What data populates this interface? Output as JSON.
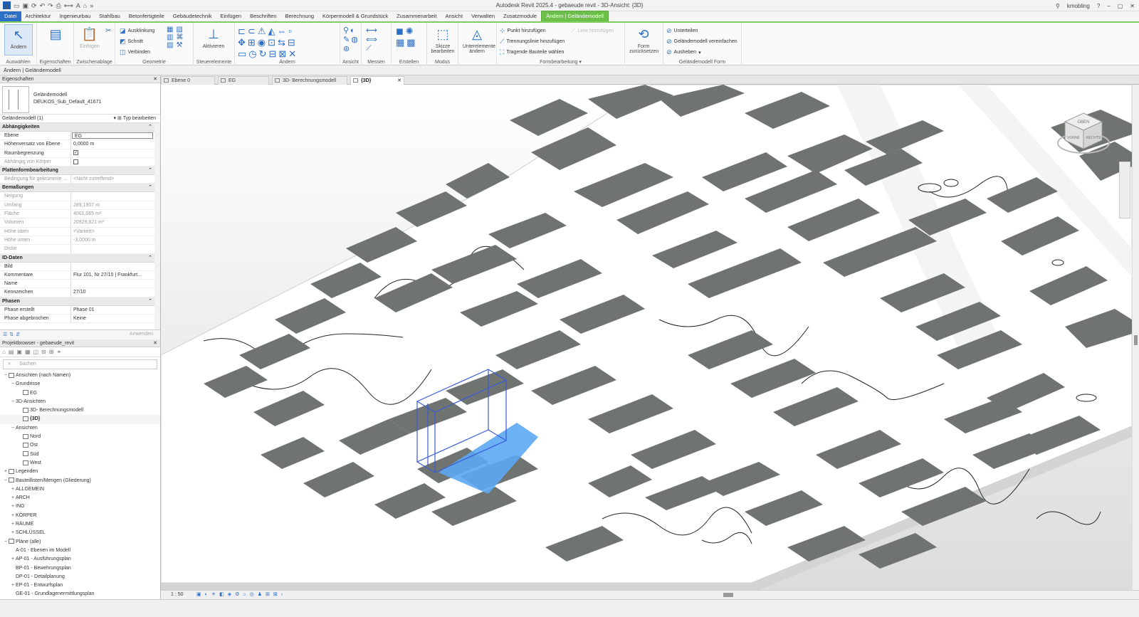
{
  "app": {
    "title": "Autodesk Revit 2025.4 - gebaeude revit - 3D-Ansicht: {3D}",
    "user": "kmobling",
    "logo_letter": "R"
  },
  "menu": {
    "tabs": [
      "Datei",
      "Architektur",
      "Ingenieurbau",
      "Stahlbau",
      "Betonfertigteile",
      "Gebäudetechnik",
      "Einfügen",
      "Beschriften",
      "Berechnung",
      "Körpermodell & Grundstück",
      "Zusammenarbeit",
      "Ansicht",
      "Verwalten",
      "Zusatzmodule",
      "Ändern | Geländemodell"
    ]
  },
  "ribbon": {
    "select": {
      "button": "Ändern",
      "label": "Auswählen"
    },
    "properties": {
      "label": "Eigenschaften"
    },
    "clipboard": {
      "paste": "Einfügen",
      "label": "Zwischenablage"
    },
    "geometry": {
      "items": [
        "Ausklinkung",
        "Schnitt",
        "Verbinden"
      ],
      "label": "Geometrie"
    },
    "controls": {
      "button": "Aktivieren",
      "label": "Steuerelemente"
    },
    "modify": {
      "label": "Ändern"
    },
    "view": {
      "label": "Ansicht"
    },
    "measure": {
      "label": "Messen"
    },
    "create": {
      "label": "Erstellen"
    },
    "mode": {
      "button_1": "Skizze",
      "button_2": "bearbeiten",
      "label": "Modus"
    },
    "sub": {
      "button_1": "Unterelemente",
      "button_2": "ändern"
    },
    "shape_edit": {
      "items": [
        "Punkt hinzufügen",
        "Trennungslinie hinzufügen",
        "Tragende Bauteile wählen"
      ],
      "disabled_item": "Linie hinzufügen",
      "label": "Formbearbeitung"
    },
    "shape": {
      "button_1": "Form",
      "button_2": "zurücksetzen"
    },
    "terrain_form": {
      "items": [
        "Unterteilen",
        "Geländemodell vereinfachen",
        "Ausheben"
      ],
      "label": "Geländemodell Form"
    }
  },
  "options_bar": {
    "text": "Ändern | Geländemodell"
  },
  "properties": {
    "title": "Eigenschaften",
    "type_name_1": "Geländemodell",
    "type_name_2": "DEUKOS_Sub_Default_41671",
    "instance": "Geländemodell (1)",
    "edit_type": "Typ bearbeiten",
    "apply": "Anwenden",
    "groups": [
      {
        "name": "Abhängigkeiten",
        "rows": [
          {
            "k": "Ebene",
            "v": "EG",
            "boxed": true
          },
          {
            "k": "Höhenversatz von Ebene",
            "v": "0,0000 m"
          },
          {
            "k": "Raumbegrenzung",
            "v": "✓",
            "check": true
          },
          {
            "k": "Abhängig von Körper",
            "v": "",
            "check": true,
            "dim": true
          }
        ]
      },
      {
        "name": "Plattenformbearbeitung",
        "rows": [
          {
            "k": "Bedingung für gekrümmte ...",
            "v": "<Nicht zutreffend>",
            "dim": true
          }
        ]
      },
      {
        "name": "Bemaßungen",
        "rows": [
          {
            "k": "Neigung",
            "v": "",
            "dim": true
          },
          {
            "k": "Umfang",
            "v": "289,1907 m",
            "dim": true
          },
          {
            "k": "Fläche",
            "v": "4001,065 m²",
            "dim": true
          },
          {
            "k": "Volumen",
            "v": "20929,821 m³",
            "dim": true
          },
          {
            "k": "Höhe oben",
            "v": "<Variiert>",
            "dim": true
          },
          {
            "k": "Höhe unten",
            "v": "-3,0000 m",
            "dim": true
          },
          {
            "k": "Dicke",
            "v": "",
            "dim": true
          }
        ]
      },
      {
        "name": "ID-Daten",
        "rows": [
          {
            "k": "Bild",
            "v": ""
          },
          {
            "k": "Kommentare",
            "v": "Flur 101, Nr 27/10 | Frankfurt..."
          },
          {
            "k": "Name",
            "v": ""
          },
          {
            "k": "Kennzeichen",
            "v": "27/10"
          }
        ]
      },
      {
        "name": "Phasen",
        "rows": [
          {
            "k": "Phase erstellt",
            "v": "Phase 01"
          },
          {
            "k": "Phase abgebrochen",
            "v": "Keine"
          }
        ]
      }
    ]
  },
  "browser": {
    "title": "Projektbrowser - gebaeude_revit",
    "search_placeholder": "Suchen",
    "tree": [
      {
        "d": 0,
        "t": "−",
        "l": "Ansichten (nach Namen)",
        "icon": true
      },
      {
        "d": 1,
        "t": "−",
        "l": "Grundrisse"
      },
      {
        "d": 2,
        "t": "",
        "l": "EG",
        "icon": true
      },
      {
        "d": 1,
        "t": "−",
        "l": "3D-Ansichten"
      },
      {
        "d": 2,
        "t": "",
        "l": "3D- Berechnungsmodell",
        "icon": true
      },
      {
        "d": 2,
        "t": "",
        "l": "{3D}",
        "icon": true,
        "bold": true,
        "sel": true
      },
      {
        "d": 1,
        "t": "−",
        "l": "Ansichten"
      },
      {
        "d": 2,
        "t": "",
        "l": "Nord",
        "icon": true
      },
      {
        "d": 2,
        "t": "",
        "l": "Ost",
        "icon": true
      },
      {
        "d": 2,
        "t": "",
        "l": "Süd",
        "icon": true
      },
      {
        "d": 2,
        "t": "",
        "l": "West",
        "icon": true
      },
      {
        "d": 0,
        "t": "+",
        "l": "Legenden",
        "icon": true
      },
      {
        "d": 0,
        "t": "−",
        "l": "Bauteillisten/Mengen (Gliederung)",
        "icon": true
      },
      {
        "d": 1,
        "t": "+",
        "l": "ALLGEMEIN"
      },
      {
        "d": 1,
        "t": "+",
        "l": "ARCH"
      },
      {
        "d": 1,
        "t": "+",
        "l": "ING"
      },
      {
        "d": 1,
        "t": "+",
        "l": "KÖRPER"
      },
      {
        "d": 1,
        "t": "+",
        "l": "RÄUME"
      },
      {
        "d": 1,
        "t": "+",
        "l": "SCHLÜSSEL"
      },
      {
        "d": 0,
        "t": "−",
        "l": "Pläne (alle)",
        "icon": true
      },
      {
        "d": 1,
        "t": "",
        "l": "A-01 - Ebenen im Modell"
      },
      {
        "d": 1,
        "t": "+",
        "l": "AP-01 - Ausführungsplan"
      },
      {
        "d": 1,
        "t": "",
        "l": "BP-01 - Bewehrungsplan"
      },
      {
        "d": 1,
        "t": "",
        "l": "DP-01 - Detailplanung"
      },
      {
        "d": 1,
        "t": "+",
        "l": "EP-01 - Entwurfsplan"
      },
      {
        "d": 1,
        "t": "",
        "l": "GE-01 - Grundlagenermittlungsplan"
      }
    ]
  },
  "view_tabs": [
    {
      "label": "Ebene 0",
      "active": false
    },
    {
      "label": "EG",
      "active": false
    },
    {
      "label": "3D- Berechnungsmodell",
      "active": false
    },
    {
      "label": "{3D}",
      "active": true
    }
  ],
  "viewcube": {
    "front": "VORNE",
    "right": "RECHTS",
    "top": "OBEN"
  },
  "view_control": {
    "scale": "1 : 50"
  },
  "colors": {
    "accent": "#2b6fc7",
    "context_tab": "#6cc04a",
    "roof": "#6f7470",
    "selection": "#5ba8f2"
  }
}
